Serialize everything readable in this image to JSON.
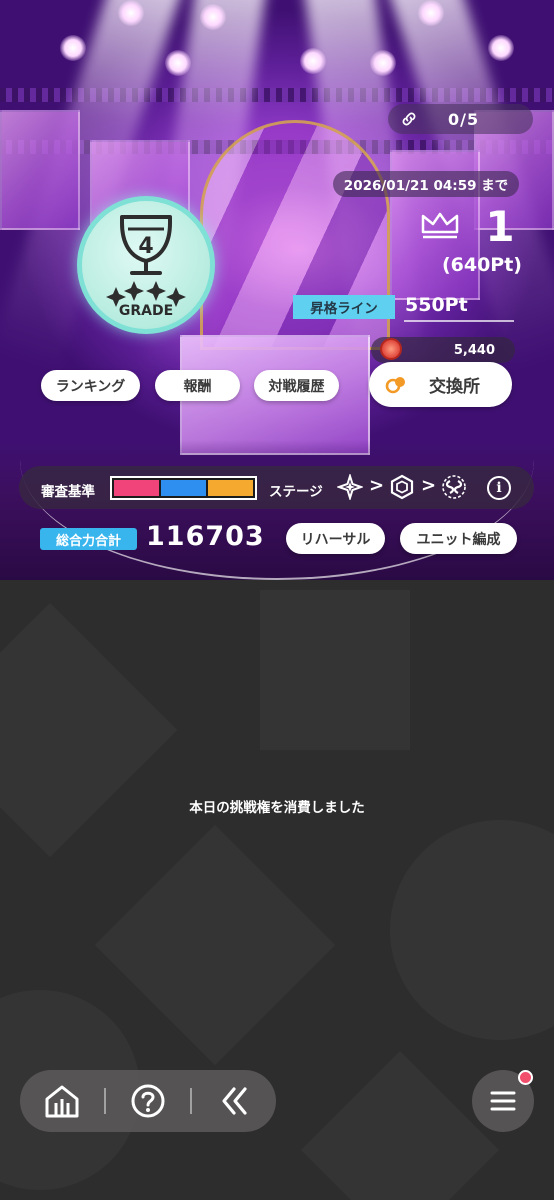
{
  "connection": {
    "count": "0/5",
    "icon": "chain-link-icon"
  },
  "deadline": "2026/01/21 04:59 まで",
  "grade": {
    "number": "4",
    "label": "GRADE",
    "icon": "trophy-cup-icon",
    "color": "#7fe0d6"
  },
  "rank": {
    "position": "1",
    "points": "(640Pt)",
    "icon": "crown-icon"
  },
  "promotion": {
    "label": "昇格ライン",
    "value": "550Pt"
  },
  "buttons": {
    "ranking": "ランキング",
    "reward": "報酬",
    "history": "対戦履歴"
  },
  "exchange": {
    "coins": "5,440",
    "label": "交換所",
    "coin_icon": "medal-coin-icon",
    "icon": "exchange-icon"
  },
  "criteria": {
    "label": "審査基準",
    "colors": [
      "#f0447a",
      "#2f8ff0",
      "#f5aa2f"
    ],
    "stage_label": "ステージ",
    "stage_icons": [
      "star-burst-icon",
      "cube-icon",
      "infinity-loop-icon"
    ],
    "arrow": ">"
  },
  "power": {
    "label": "総合力合計",
    "value": "116703"
  },
  "actions": {
    "rehearsal": "リハーサル",
    "unit_edit": "ユニット編成"
  },
  "message": "本日の挑戦権を消費しました",
  "nav": {
    "home_icon": "home-icon",
    "help_icon": "help-icon",
    "back_icon": "back-chevron-icon",
    "menu_icon": "menu-icon",
    "badge_color": "#f24f6d"
  }
}
